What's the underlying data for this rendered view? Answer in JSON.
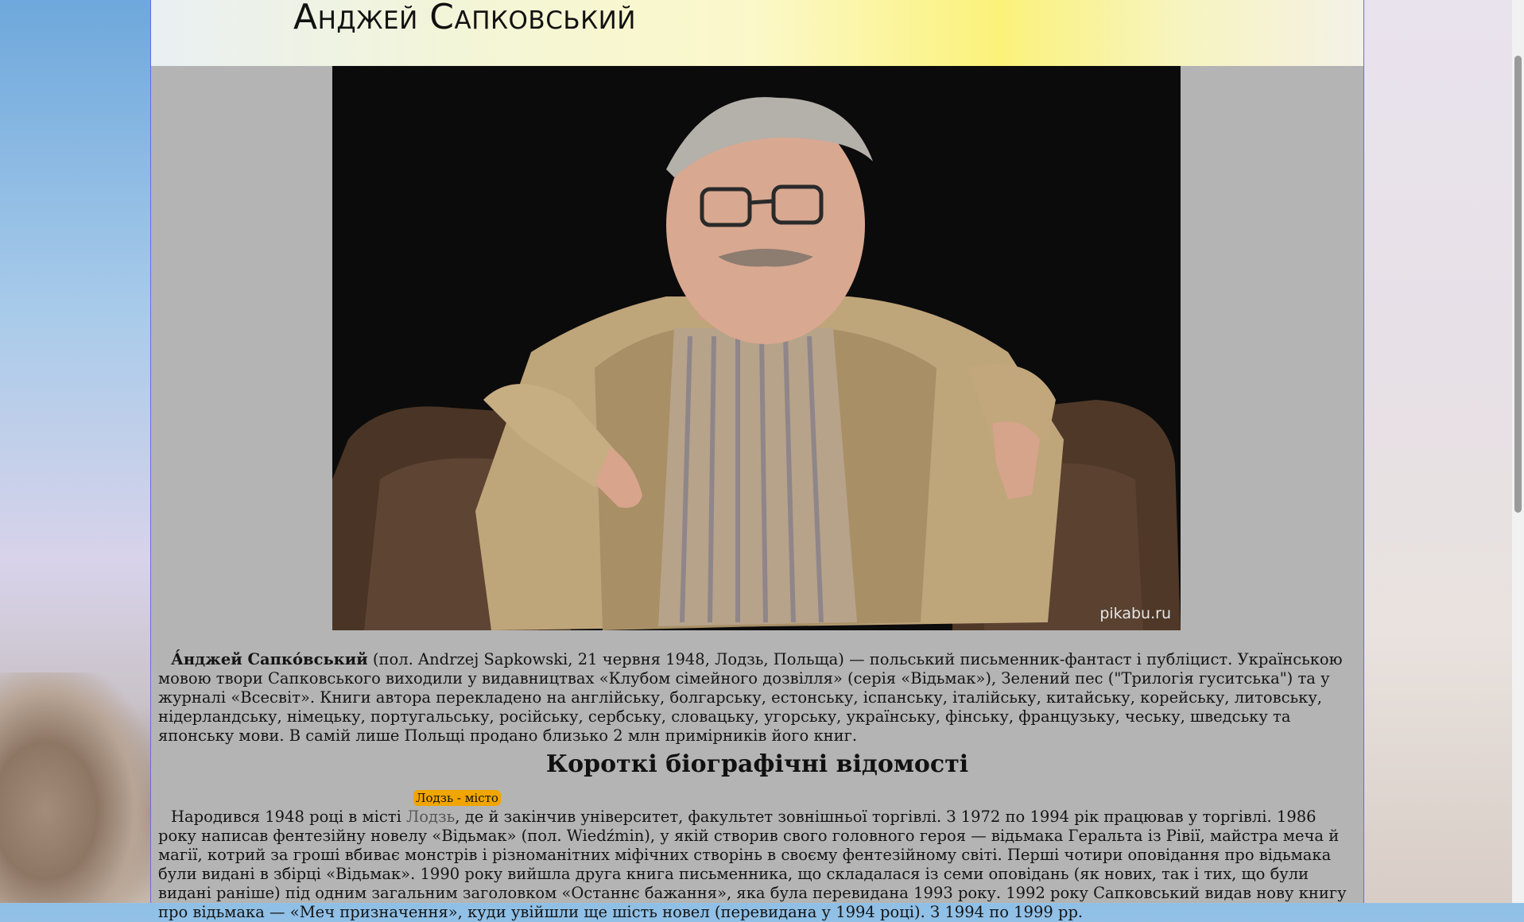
{
  "header": {
    "title": "Анджей Сапковський"
  },
  "photo": {
    "alt": "Photo of Andrzej Sapkowski seated in a leather armchair",
    "watermark": "pikabu.ru"
  },
  "intro": {
    "name_bold": "А́нджей Сапко́вський",
    "text": " (пол. Andrzej Sapkowski, 21 червня 1948, Лодзь, Польща) — польський письменник-фантаст і публіцист. Українською мовою твори Сапковського виходили у видавництвах «Клубом сімейного дозвілля» (серія «Відьмак»), Зелений пес (\"Трилогія гуситська\") та у журналі «Всесвіт». Книги автора перекладено на англійську, болгарську, естонську, іспанську, італійську, китайську, корейську, литовську, нідерландську, німецьку, португальську, російську, сербську, словацьку, угорську, українську, фінську, французьку, чеську, шведську та японську мови. В самій лише Польщі продано близько 2 млн примірників його книг."
  },
  "section": {
    "heading": "Короткі біографічні відомості"
  },
  "tooltip": {
    "text": "Лодзь - місто"
  },
  "bio": {
    "before": "Народився 1948 році в місті ",
    "link": "Лодзь",
    "after": ", де й закінчив університет, факультет зовнішньої торгівлі. З 1972 по 1994 рік працював у торгівлі. 1986 року написав фентезійну новелу «Відьмак» (пол. Wiedźmin), у якій створив свого головного героя — відьмака Геральта із Рівії, майстра меча й магії, котрий за гроші вбиває монстрів і різноманітних міфічних створінь в своєму фентезійному світі. Перші чотири оповідання про відьмака були видані в збірці «Відьмак». 1990 року вийшла друга книга письменника, що складалася із семи оповідань (як нових, так і тих, що були видані раніше) під одним загальним заголовком «Останнє бажання», яка була перевидана 1993 року. 1992 року Сапковський видав нову книгу про відьмака — «Меч призначення», куди увійшли ще шість новел (перевидана у 1994 році). З 1994 по 1999 рр."
  },
  "colors": {
    "tooltip_bg": "#f0a500",
    "page_bg": "#b4b4b4",
    "border": "#6a6ae0"
  }
}
